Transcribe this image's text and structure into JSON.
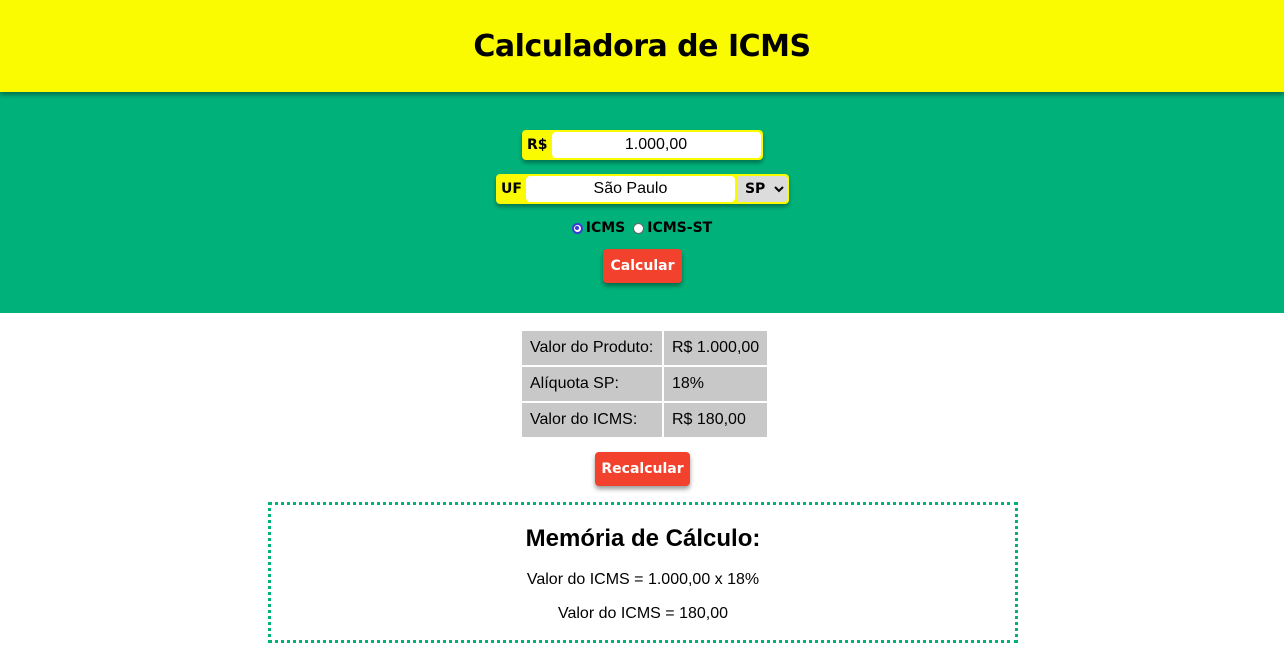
{
  "header": {
    "title": "Calculadora de ICMS"
  },
  "form": {
    "value_field": {
      "prefix": "R$",
      "value": "1.000,00"
    },
    "uf_field": {
      "prefix": "UF",
      "state_name": "São Paulo",
      "selected_uf": "SP"
    },
    "tax_type": {
      "options": [
        {
          "label": "ICMS",
          "checked": true
        },
        {
          "label": "ICMS-ST",
          "checked": false
        }
      ]
    },
    "calculate_label": "Calcular"
  },
  "results": {
    "rows": [
      {
        "label": "Valor do Produto:",
        "value": "R$ 1.000,00"
      },
      {
        "label": "Alíquota SP:",
        "value": "18%"
      },
      {
        "label": "Valor do ICMS:",
        "value": "R$ 180,00"
      }
    ],
    "recalculate_label": "Recalcular"
  },
  "memory": {
    "title": "Memória de Cálculo:",
    "lines": [
      "Valor do ICMS = 1.000,00 x 18%",
      "Valor do ICMS = 180,00"
    ]
  },
  "colors": {
    "header_bg": "#fafa00",
    "form_bg": "#00b27a",
    "button_bg": "#f2422e",
    "table_cell_bg": "#c8c8c8"
  }
}
